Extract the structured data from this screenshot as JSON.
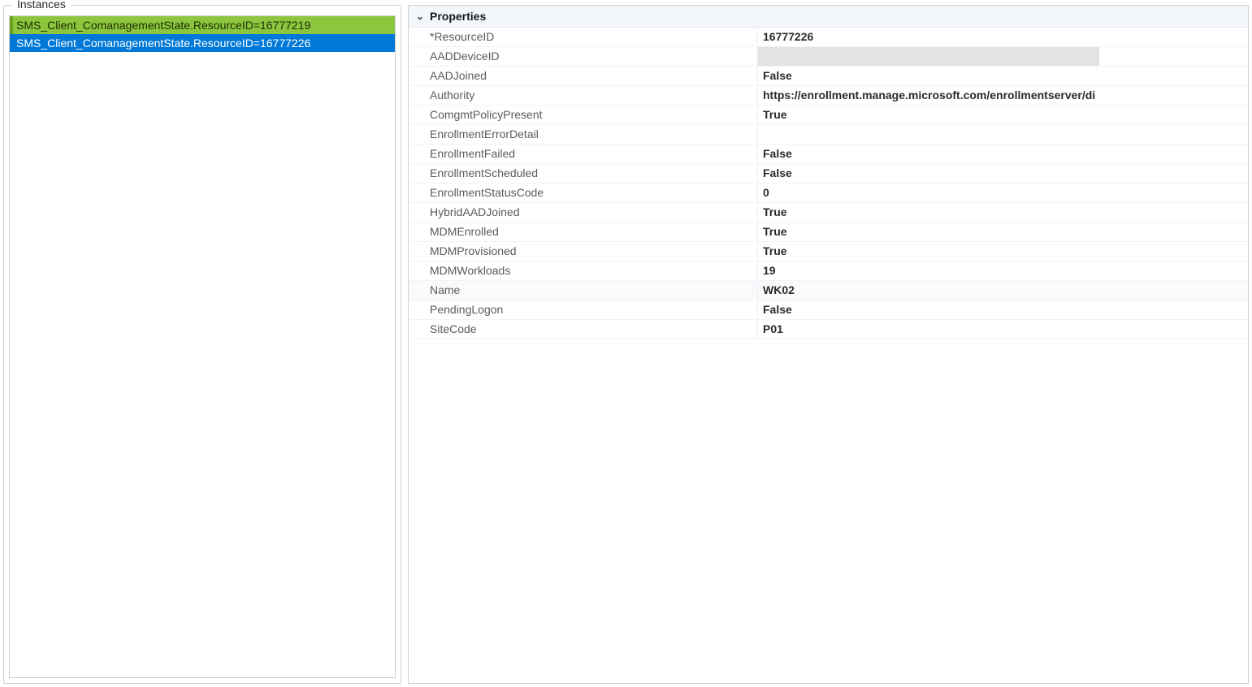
{
  "instances_panel": {
    "title": "Instances",
    "items": [
      {
        "label": "SMS_Client_ComanagementState.ResourceID=16777219",
        "state": "highlight-green"
      },
      {
        "label": "SMS_Client_ComanagementState.ResourceID=16777226",
        "state": "selected"
      }
    ]
  },
  "properties_panel": {
    "section_title": "Properties",
    "rows": [
      {
        "name": "*ResourceID",
        "value": "16777226"
      },
      {
        "name": "AADDeviceID",
        "value": "",
        "redacted": true
      },
      {
        "name": "AADJoined",
        "value": "False"
      },
      {
        "name": "Authority",
        "value": "https://enrollment.manage.microsoft.com/enrollmentserver/di"
      },
      {
        "name": "ComgmtPolicyPresent",
        "value": "True"
      },
      {
        "name": "EnrollmentErrorDetail",
        "value": ""
      },
      {
        "name": "EnrollmentFailed",
        "value": "False"
      },
      {
        "name": "EnrollmentScheduled",
        "value": "False"
      },
      {
        "name": "EnrollmentStatusCode",
        "value": "0"
      },
      {
        "name": "HybridAADJoined",
        "value": "True"
      },
      {
        "name": "MDMEnrolled",
        "value": "True"
      },
      {
        "name": "MDMProvisioned",
        "value": "True"
      },
      {
        "name": "MDMWorkloads",
        "value": "19"
      },
      {
        "name": "Name",
        "value": "WK02",
        "alt": true
      },
      {
        "name": "PendingLogon",
        "value": "False"
      },
      {
        "name": "SiteCode",
        "value": "P01"
      }
    ]
  }
}
